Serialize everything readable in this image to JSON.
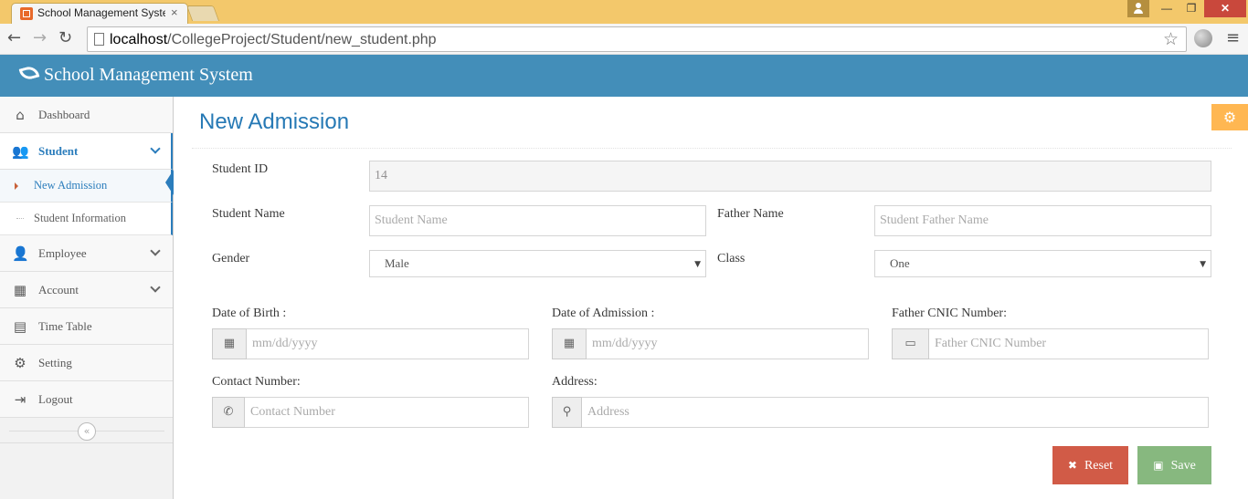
{
  "browser": {
    "tab_title": "School Management System",
    "tab_close": "×",
    "url_host": "localhost",
    "url_path": "/CollegeProject/Student/new_student.php",
    "window_controls": {
      "minimize": "—",
      "maximize": "❐",
      "close": "✕"
    }
  },
  "app": {
    "brand": "School Management System",
    "brand_icon": "leaf-icon"
  },
  "sidebar": {
    "items": [
      {
        "label": "Dashboard",
        "icon": "home-icon"
      },
      {
        "label": "Student",
        "icon": "users-icon"
      },
      {
        "label": "Employee",
        "icon": "user-tie-icon"
      },
      {
        "label": "Account",
        "icon": "calculator-icon"
      },
      {
        "label": "Time Table",
        "icon": "calendar-icon"
      },
      {
        "label": "Setting",
        "icon": "gear-icon"
      },
      {
        "label": "Logout",
        "icon": "sign-out-icon"
      }
    ],
    "sub_items": [
      {
        "label": "New Admission"
      },
      {
        "label": "Student Information"
      }
    ]
  },
  "page": {
    "title": "New Admission"
  },
  "form": {
    "student_id": {
      "label": "Student ID",
      "value": "14"
    },
    "student_name": {
      "label": "Student Name",
      "placeholder": "Student Name"
    },
    "father_name": {
      "label": "Father Name",
      "placeholder": "Student Father Name"
    },
    "gender": {
      "label": "Gender",
      "value": "Male"
    },
    "class": {
      "label": "Class",
      "value": "One"
    },
    "dob": {
      "label": "Date of Birth :",
      "placeholder": "mm/dd/yyyy"
    },
    "doa": {
      "label": "Date of Admission :",
      "placeholder": "mm/dd/yyyy"
    },
    "cnic": {
      "label": "Father CNIC Number:",
      "placeholder": "Father CNIC Number"
    },
    "contact": {
      "label": "Contact Number:",
      "placeholder": "Contact Number"
    },
    "address": {
      "label": "Address:",
      "placeholder": "Address"
    }
  },
  "buttons": {
    "reset": "Reset",
    "save": "Save"
  },
  "colors": {
    "header": "#438eb9",
    "accent": "#2b7dbc",
    "reset": "#d15b47",
    "save": "#87b87f",
    "settings": "#ffb752"
  }
}
